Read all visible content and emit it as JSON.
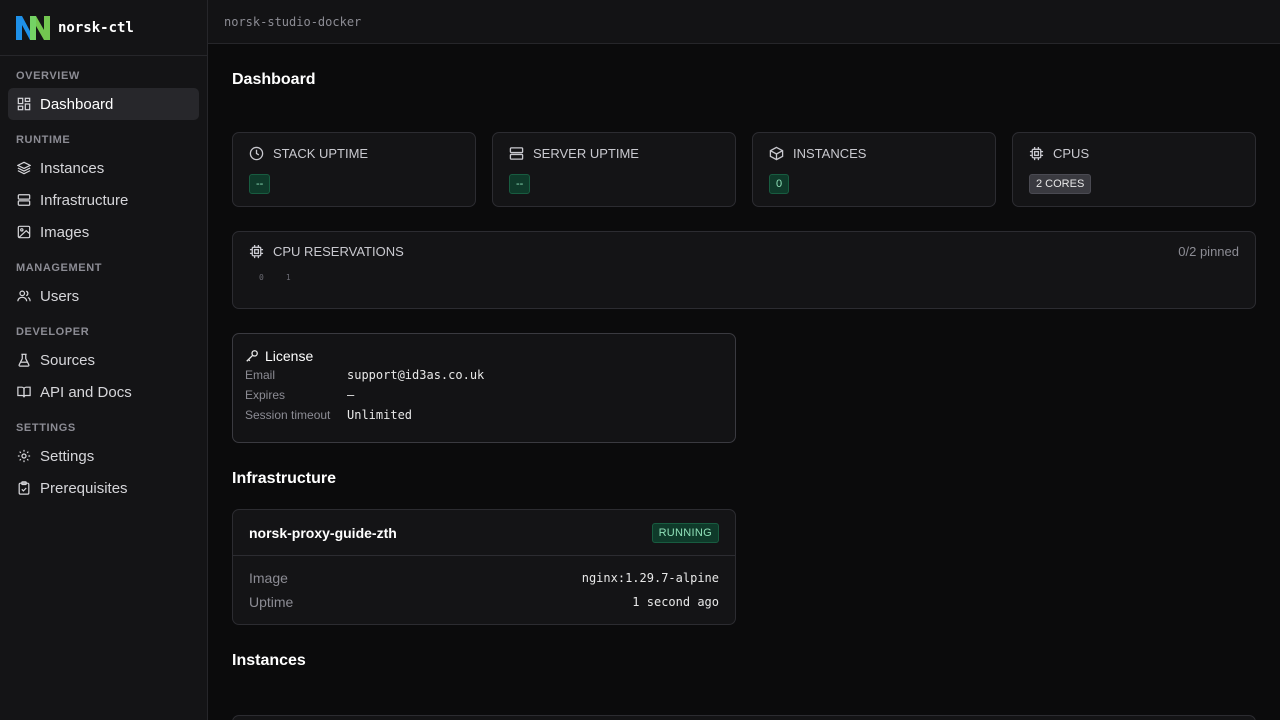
{
  "brand": {
    "name": "norsk-ctl"
  },
  "topbar": {
    "breadcrumb": "norsk-studio-docker"
  },
  "sidebar": {
    "sections": [
      {
        "title": "OVERVIEW",
        "items": [
          {
            "label": "Dashboard",
            "icon": "dashboard-icon",
            "active": true
          }
        ]
      },
      {
        "title": "RUNTIME",
        "items": [
          {
            "label": "Instances",
            "icon": "layers-icon"
          },
          {
            "label": "Infrastructure",
            "icon": "server-icon"
          },
          {
            "label": "Images",
            "icon": "image-icon"
          }
        ]
      },
      {
        "title": "MANAGEMENT",
        "items": [
          {
            "label": "Users",
            "icon": "users-icon"
          }
        ]
      },
      {
        "title": "DEVELOPER",
        "items": [
          {
            "label": "Sources",
            "icon": "flask-icon"
          },
          {
            "label": "API and Docs",
            "icon": "book-icon"
          }
        ]
      },
      {
        "title": "SETTINGS",
        "items": [
          {
            "label": "Settings",
            "icon": "gear-icon"
          },
          {
            "label": "Prerequisites",
            "icon": "clipboard-icon"
          }
        ]
      }
    ]
  },
  "page": {
    "title": "Dashboard"
  },
  "stats": [
    {
      "label": "STACK UPTIME",
      "value": "--",
      "icon": "clock-icon",
      "style": "green"
    },
    {
      "label": "SERVER UPTIME",
      "value": "--",
      "icon": "server-icon",
      "style": "green"
    },
    {
      "label": "INSTANCES",
      "value": "0",
      "icon": "cube-icon",
      "style": "green"
    },
    {
      "label": "CPUS",
      "value": "2 CORES",
      "icon": "cpu-icon",
      "style": "gray"
    }
  ],
  "cpu_reservations": {
    "label": "CPU RESERVATIONS",
    "pinned": "0/2 pinned",
    "cores": [
      "0",
      "1"
    ]
  },
  "license": {
    "title": "License",
    "rows": [
      {
        "key": "Email",
        "value": "support@id3as.co.uk"
      },
      {
        "key": "Expires",
        "value": "—"
      },
      {
        "key": "Session timeout",
        "value": "Unlimited"
      }
    ]
  },
  "infrastructure": {
    "title": "Infrastructure",
    "card": {
      "name": "norsk-proxy-guide-zth",
      "status": "RUNNING",
      "rows": [
        {
          "key": "Image",
          "value": "nginx:1.29.7-alpine"
        },
        {
          "key": "Uptime",
          "value": "1 second ago"
        }
      ]
    }
  },
  "instances": {
    "title": "Instances"
  },
  "colors": {
    "accent_green_bg": "#0f3a2a",
    "accent_green_text": "#8fe0b8",
    "sidebar_bg": "#141416",
    "active_item_bg": "#27272b"
  }
}
